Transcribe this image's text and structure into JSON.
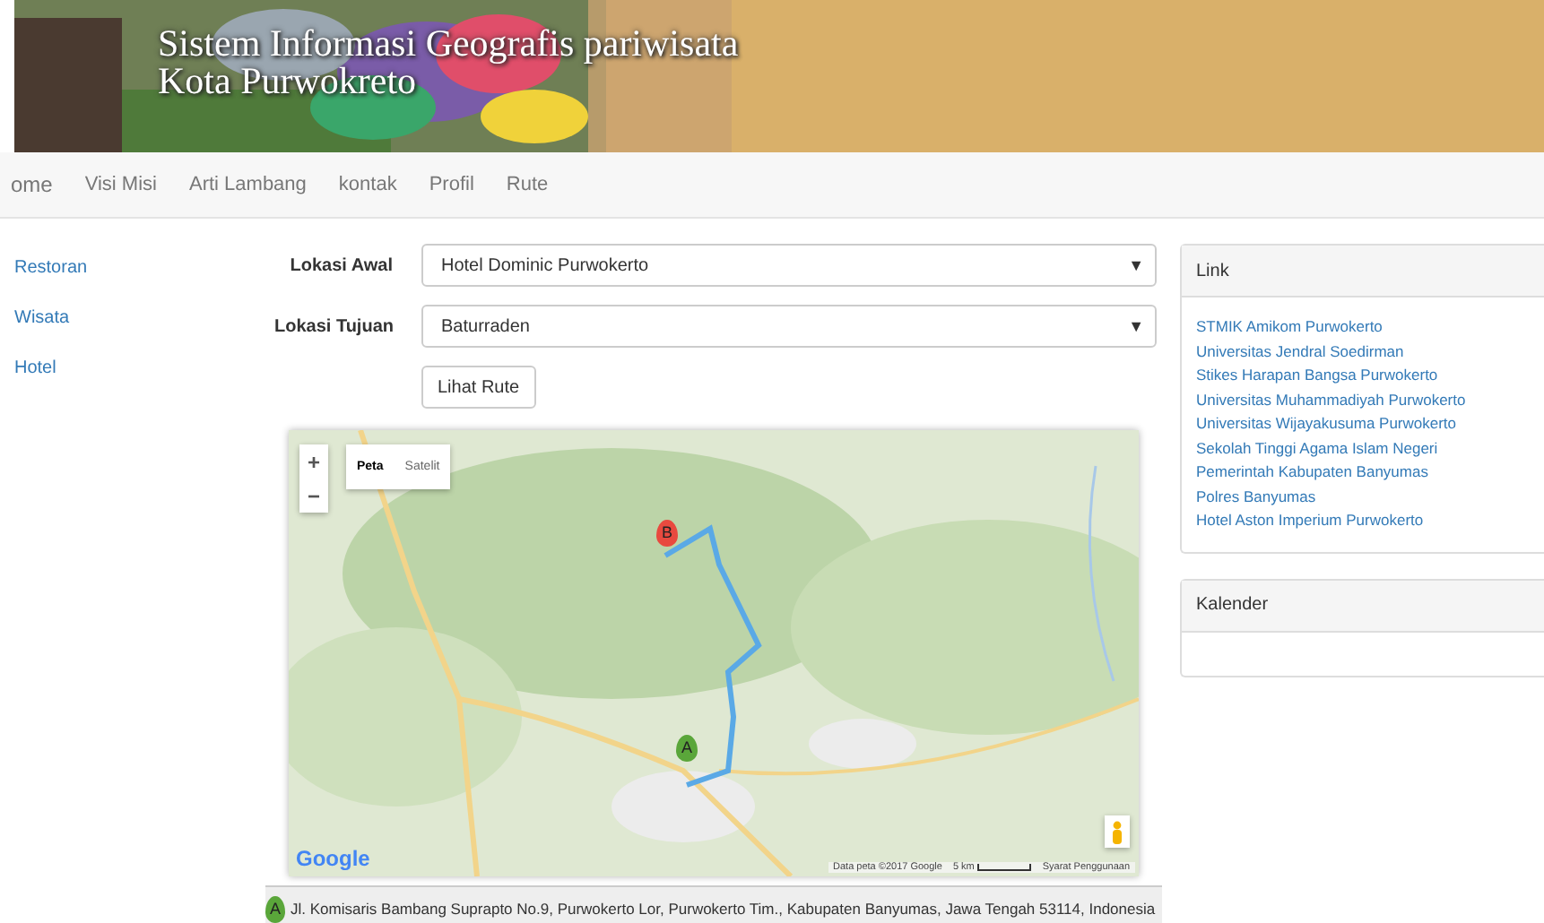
{
  "header": {
    "title_line_1": "Sistem Informasi Geografis pariwisata",
    "title_line_2": "Kota Purwokreto"
  },
  "nav": [
    {
      "label": "ome"
    },
    {
      "label": "Visi Misi"
    },
    {
      "label": "Arti Lambang"
    },
    {
      "label": "kontak"
    },
    {
      "label": "Profil"
    },
    {
      "label": "Rute"
    }
  ],
  "sidebar": {
    "items": [
      "Restoran",
      "Wisata",
      "Hotel"
    ]
  },
  "form": {
    "fields": [
      {
        "label": "Lokasi Awal",
        "value": "Hotel Dominic Purwokerto",
        "caret": "▼"
      },
      {
        "label": "Lokasi Tujuan",
        "value": "Baturraden",
        "caret": "▼"
      }
    ],
    "button": "Lihat Rute"
  },
  "map": {
    "zoom_in": "+",
    "zoom_out": "−",
    "types": [
      {
        "label": "Peta",
        "selected": true
      },
      {
        "label": "Satelit",
        "selected": false
      }
    ],
    "markers": [
      {
        "letter": "B",
        "color": "#e84a3f"
      },
      {
        "letter": "A",
        "color": "#5aa63a"
      }
    ],
    "logo": "Google",
    "attribution": "Data peta ©2017 Google",
    "scale": "5 km",
    "terms": "Syarat Penggunaan"
  },
  "route_step": {
    "marker": "A",
    "address": "Jl. Komisaris Bambang Suprapto No.9, Purwokerto Lor, Purwokerto Tim., Kabupaten Banyumas, Jawa Tengah 53114, Indonesia"
  },
  "panels": [
    {
      "title": "Link",
      "links": [
        "STMIK Amikom Purwokerto",
        "Universitas Jendral Soedirman",
        "Stikes Harapan Bangsa Purwokerto",
        "Universitas Muhammadiyah Purwokerto",
        "Universitas Wijayakusuma Purwokerto",
        "Sekolah Tinggi Agama Islam Negeri",
        "Pemerintah Kabupaten Banyumas",
        "Polres Banyumas",
        "Hotel Aston Imperium Purwokerto"
      ]
    },
    {
      "title": "Kalender"
    }
  ]
}
